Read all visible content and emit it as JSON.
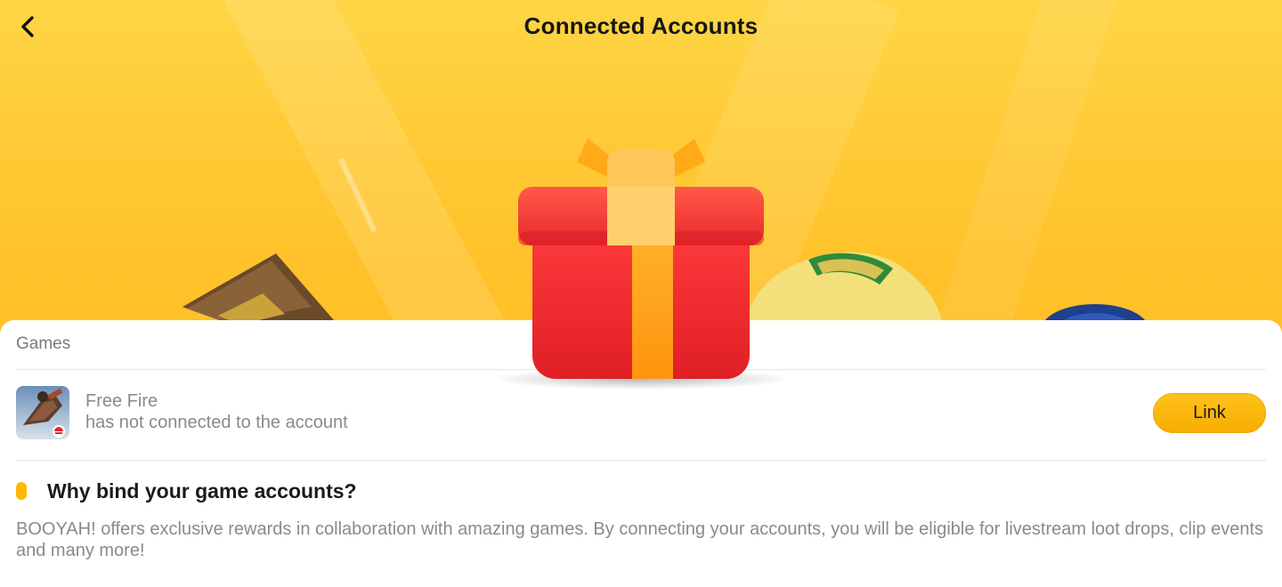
{
  "header": {
    "title": "Connected Accounts",
    "back_icon": "chevron-left-icon"
  },
  "hero": {
    "background_color": "#ffc93a",
    "illustration": "gift-box-icon"
  },
  "games_section": {
    "label": "Games",
    "items": [
      {
        "icon": "free-fire-game-icon",
        "name": "Free Fire",
        "status": "has not connected to the account",
        "action_label": "Link"
      }
    ]
  },
  "info": {
    "title": "Why bind your game accounts?",
    "description": "BOOYAH! offers exclusive rewards in collaboration with amazing games. By connecting your accounts, you will be eligible for livestream loot drops, clip events and many more!"
  },
  "colors": {
    "accent": "#ffb800",
    "link_button": "#f7ad00",
    "gift_red": "#e8232a"
  }
}
